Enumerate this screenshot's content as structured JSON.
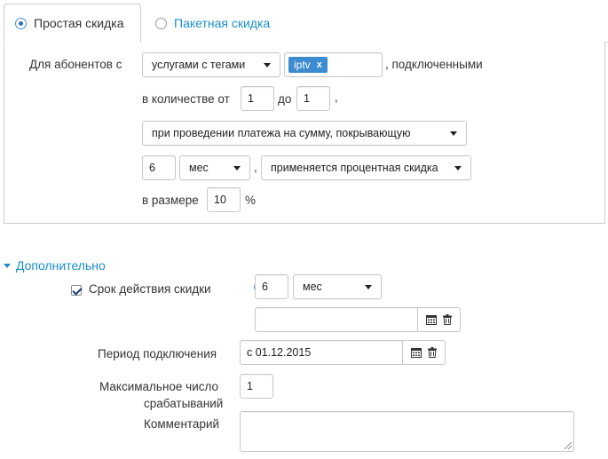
{
  "tabs": [
    {
      "label": "Простая скидка",
      "selected": true
    },
    {
      "label": "Пакетная скидка",
      "selected": false
    }
  ],
  "rule": {
    "for_subscribers_label": "Для абонентов с",
    "services_select": "услугами с тегами",
    "tag": "iptv",
    "tag_remove": "x",
    "connected_suffix": ", подключенными",
    "qty_from_label": "в количестве от",
    "qty_from": "1",
    "qty_to_label": "до",
    "qty_to": "1",
    "qty_comma": ",",
    "payment_select": "при проведении платежа на сумму, покрывающую",
    "period_value": "6",
    "period_unit": "мес",
    "period_comma": ",",
    "discount_type_select": "применяется процентная скидка",
    "size_label": "в размере",
    "size_value": "10",
    "size_unit": "%"
  },
  "additional": {
    "toggle_label": "Дополнительно",
    "validity_label": "Срок действия скидки",
    "validity_checked": true,
    "validity_value": "6",
    "validity_unit": "мес",
    "validity_date_value": "",
    "connection_period_label": "Период подключения",
    "connection_period_value": "с 01.12.2015",
    "max_triggers_label_line1": "Максимальное число",
    "max_triggers_label_line2": "срабатываний",
    "max_triggers_value": "1",
    "comment_label": "Комментарий",
    "comment_value": ""
  },
  "colors": {
    "accent": "#1a8fc9",
    "tag": "#3d8bd1"
  }
}
